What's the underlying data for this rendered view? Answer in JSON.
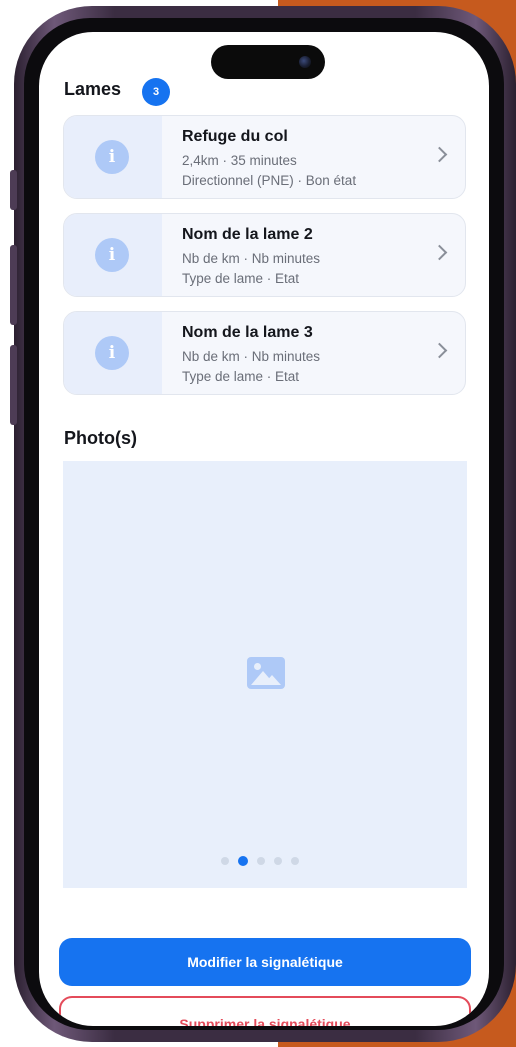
{
  "lames": {
    "title": "Lames",
    "count": "3",
    "items": [
      {
        "title": "Refuge du col",
        "line1": "2,4km · 35 minutes",
        "line2": "Directionnel (PNE) · Bon état"
      },
      {
        "title": "Nom de la lame 2",
        "line1": "Nb de km · Nb minutes",
        "line2": "Type de lame · Etat"
      },
      {
        "title": "Nom de la lame 3",
        "line1": "Nb de km · Nb minutes",
        "line2": "Type de lame · Etat"
      }
    ]
  },
  "photos": {
    "title": "Photo(s)",
    "carousel": {
      "total": 5,
      "active_index": 1
    }
  },
  "actions": {
    "primary_label": "Modifier la signalétique",
    "danger_label": "Supprimer la signalétique"
  },
  "colors": {
    "accent": "#1673f0",
    "danger": "#e44b5a",
    "background_accent": "#c65a1e"
  }
}
